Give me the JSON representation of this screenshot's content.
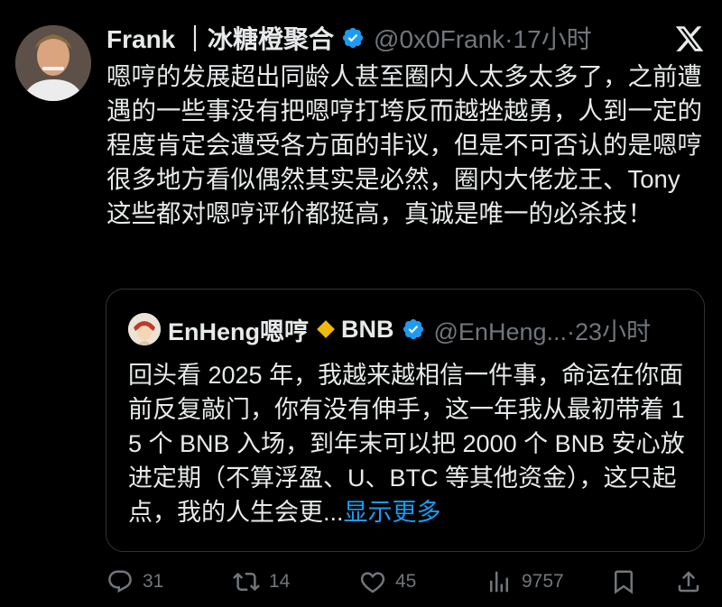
{
  "tweet": {
    "name": "Frank ｜冰糖橙聚合",
    "handle": "@0x0Frank·17小时",
    "text": "嗯哼的发展超出同龄人甚至圈内人太多太多了，之前遭遇的一些事没有把嗯哼打垮反而越挫越勇，人到一定的程度肯定会遭受各方面的非议，但是不可否认的是嗯哼很多地方看似偶然其实是必然，圈内大佬龙王、Tony 这些都对嗯哼评价都挺高，真诚是唯一的必杀技！",
    "icons": {
      "verified": "verified-badge-icon",
      "brand": "x-logo-icon"
    }
  },
  "quote": {
    "name": "EnHeng嗯哼",
    "badge_text": "BNB",
    "handle": "@EnHeng...·23小时",
    "text": "回头看 2025 年，我越来越相信一件事，命运在你面前反复敲门，你有没有伸手，这一年我从最初带着 15 个 BNB 入场，到年末可以把 2000 个 BNB 安心放进定期（不算浮盈、U、BTC 等其他资金），这只起点，我的人生会更",
    "ellipsis": "...",
    "show_more": "显示更多",
    "colors": {
      "diamond": "#f0b90b",
      "link": "#1d9bf0"
    }
  },
  "actions": {
    "replies": "31",
    "retweets": "14",
    "likes": "45",
    "views": "9757"
  },
  "colors": {
    "background": "#000000",
    "text": "#e7e9ea",
    "muted": "#71767b",
    "verified": "#1d9bf0"
  }
}
